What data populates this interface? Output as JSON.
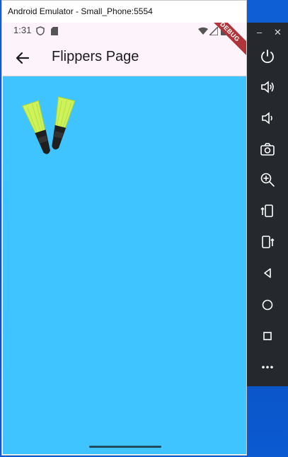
{
  "window": {
    "title": "Android Emulator - Small_Phone:5554"
  },
  "status_bar": {
    "time": "1:31"
  },
  "app_bar": {
    "title": "Flippers Page",
    "debug_banner": "DEBUG"
  },
  "toolbar": {
    "minimize": "–",
    "close": "✕",
    "buttons": [
      "power-icon",
      "volume-up-icon",
      "volume-down-icon",
      "camera-icon",
      "zoom-icon",
      "rotate-left-icon",
      "rotate-right-icon",
      "back-icon",
      "home-icon",
      "overview-icon",
      "more-icon"
    ]
  },
  "colors": {
    "page_background": "#40c4ff",
    "app_bar": "#fdf3fb",
    "toolbar": "#25292e",
    "debug_banner": "#b0353a"
  }
}
